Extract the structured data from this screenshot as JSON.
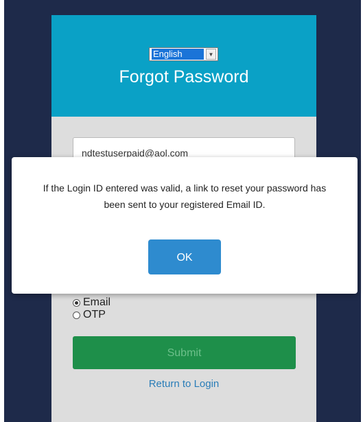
{
  "header": {
    "language_selected": "English",
    "title": "Forgot Password"
  },
  "form": {
    "email_value": "ndtestuserpaid@aol.com",
    "radio_options": [
      {
        "label": "Email",
        "checked": true
      },
      {
        "label": "OTP",
        "checked": false
      }
    ],
    "submit_label": "Submit",
    "return_link": "Return to Login"
  },
  "modal": {
    "message": "If the Login ID entered was valid, a link to reset your password has been sent to your registered Email ID.",
    "ok_label": "OK"
  },
  "colors": {
    "page_background": "#1e2a4a",
    "header_accent": "#0aa1c6",
    "submit_green": "#1e8f4a",
    "ok_blue": "#2e8bcf",
    "link_blue": "#2a7db8"
  },
  "icons": {
    "dropdown": "chevron-down-icon",
    "radio_checked": "radio-checked-icon",
    "radio_unchecked": "radio-unchecked-icon"
  }
}
